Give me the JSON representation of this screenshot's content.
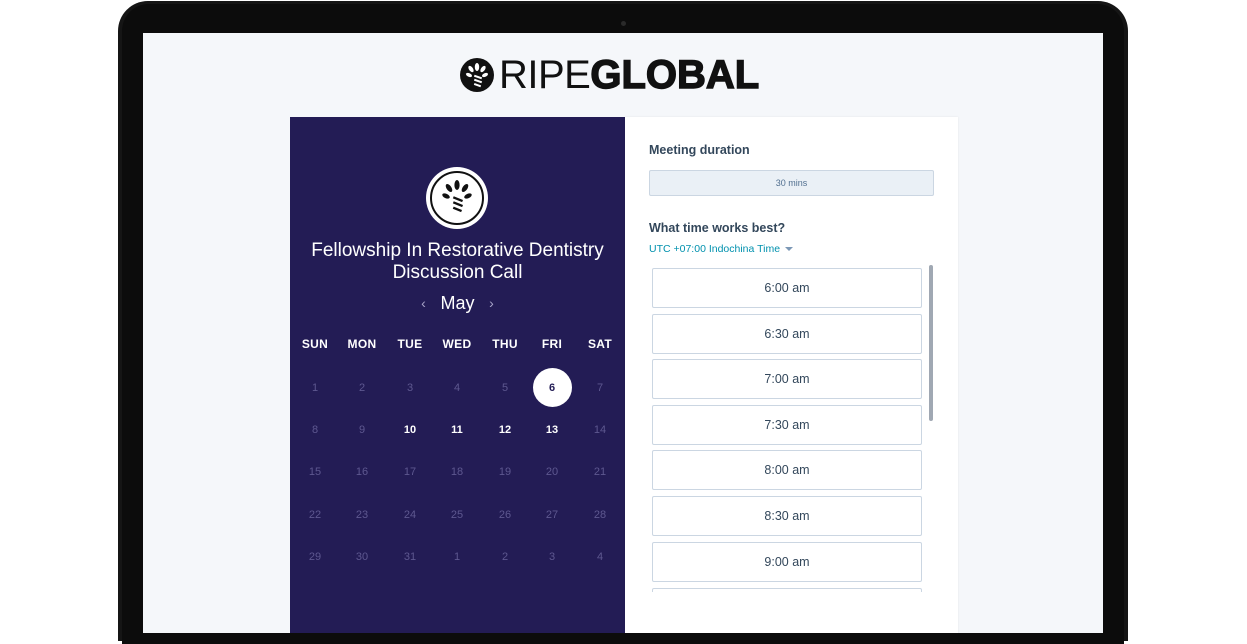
{
  "brand": {
    "logo_thin": "RIPE",
    "logo_bold": "GLOBAL"
  },
  "event": {
    "title_line1": "Fellowship In Restorative Dentistry",
    "title_line2": "Discussion Call"
  },
  "calendar": {
    "month": "May",
    "prev_icon": "chevron-left-icon",
    "next_icon": "chevron-right-icon",
    "weekdays": [
      "SUN",
      "MON",
      "TUE",
      "WED",
      "THU",
      "FRI",
      "SAT"
    ],
    "weeks": [
      [
        "1",
        "2",
        "3",
        "4",
        "5",
        "6",
        "7"
      ],
      [
        "8",
        "9",
        "10",
        "11",
        "12",
        "13",
        "14"
      ],
      [
        "15",
        "16",
        "17",
        "18",
        "19",
        "20",
        "21"
      ],
      [
        "22",
        "23",
        "24",
        "25",
        "26",
        "27",
        "28"
      ],
      [
        "29",
        "30",
        "31",
        "1",
        "2",
        "3",
        "4"
      ]
    ],
    "available_days": [
      "6",
      "10",
      "11",
      "12",
      "13"
    ],
    "selected_day": "6",
    "colors": {
      "panel_bg": "#231c55",
      "muted_day": "#5e5890"
    }
  },
  "meeting": {
    "duration_label": "Meeting duration",
    "duration_value": "30 mins",
    "time_label": "What time works best?",
    "timezone": "UTC +07:00 Indochina Time",
    "slots": [
      "6:00 am",
      "6:30 am",
      "7:00 am",
      "7:30 am",
      "8:00 am",
      "8:30 am",
      "9:00 am"
    ]
  }
}
